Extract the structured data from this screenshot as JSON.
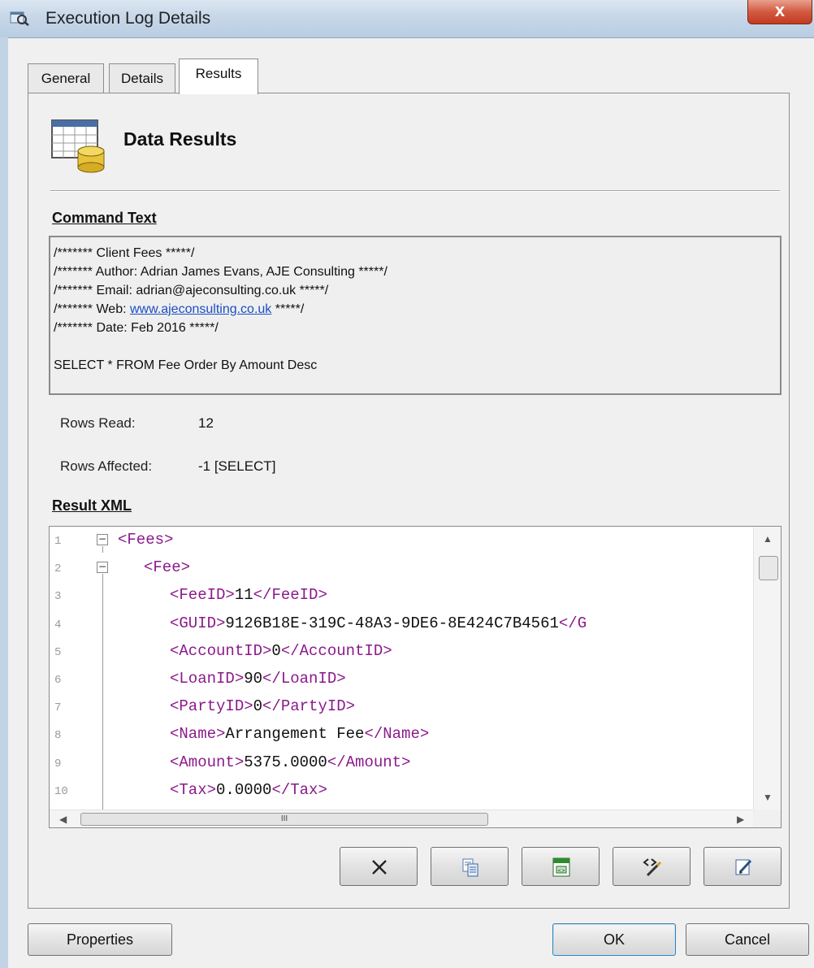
{
  "window": {
    "title": "Execution Log Details",
    "close_label": "x"
  },
  "tabs": [
    {
      "label": "General",
      "active": false
    },
    {
      "label": "Details",
      "active": false
    },
    {
      "label": "Results",
      "active": true
    }
  ],
  "header": {
    "title": "Data Results",
    "icon": "database-table-icon"
  },
  "command": {
    "heading": "Command Text",
    "lines": [
      {
        "pre": "/******* Client Fees *****/",
        "link": "",
        "post": ""
      },
      {
        "pre": "/******* Author: Adrian James Evans, AJE Consulting *****/",
        "link": "",
        "post": ""
      },
      {
        "pre": "/******* Email: adrian@ajeconsulting.co.uk *****/",
        "link": "",
        "post": ""
      },
      {
        "pre": "/******* Web: ",
        "link": "www.ajeconsulting.co.uk",
        "post": " *****/"
      },
      {
        "pre": "/******* Date: Feb 2016 *****/",
        "link": "",
        "post": ""
      },
      {
        "pre": "",
        "link": "",
        "post": ""
      },
      {
        "pre": "SELECT * FROM Fee Order By Amount Desc",
        "link": "",
        "post": ""
      }
    ]
  },
  "stats": {
    "rows_read_label": "Rows Read:",
    "rows_read_value": "12",
    "rows_affected_label": "Rows Affected:",
    "rows_affected_value": "-1 [SELECT]"
  },
  "result": {
    "heading": "Result XML",
    "line_numbers": [
      "1",
      "2",
      "3",
      "4",
      "5",
      "6",
      "7",
      "8",
      "9",
      "10"
    ],
    "lines": [
      {
        "open": "<Fees>",
        "text": "",
        "close": ""
      },
      {
        "open": "<Fee>",
        "text": "",
        "close": ""
      },
      {
        "open": "<FeeID>",
        "text": "11",
        "close": "</FeeID>"
      },
      {
        "open": "<GUID>",
        "text": "9126B18E-319C-48A3-9DE6-8E424C7B4561",
        "close": "</G"
      },
      {
        "open": "<AccountID>",
        "text": "0",
        "close": "</AccountID>"
      },
      {
        "open": "<LoanID>",
        "text": "90",
        "close": "</LoanID>"
      },
      {
        "open": "<PartyID>",
        "text": "0",
        "close": "</PartyID>"
      },
      {
        "open": "<Name>",
        "text": "Arrangement Fee",
        "close": "</Name>"
      },
      {
        "open": "<Amount>",
        "text": "5375.0000",
        "close": "</Amount>"
      },
      {
        "open": "<Tax>",
        "text": "0.0000",
        "close": "</Tax>"
      }
    ],
    "fold_symbol": "−",
    "hscroll_grip": "III"
  },
  "toolbar": {
    "buttons": [
      {
        "icon": "clear-icon"
      },
      {
        "icon": "copy-icon"
      },
      {
        "icon": "export-xml-icon"
      },
      {
        "icon": "format-xml-icon"
      },
      {
        "icon": "edit-icon"
      }
    ]
  },
  "footer": {
    "properties_label": "Properties",
    "ok_label": "OK",
    "cancel_label": "Cancel"
  }
}
